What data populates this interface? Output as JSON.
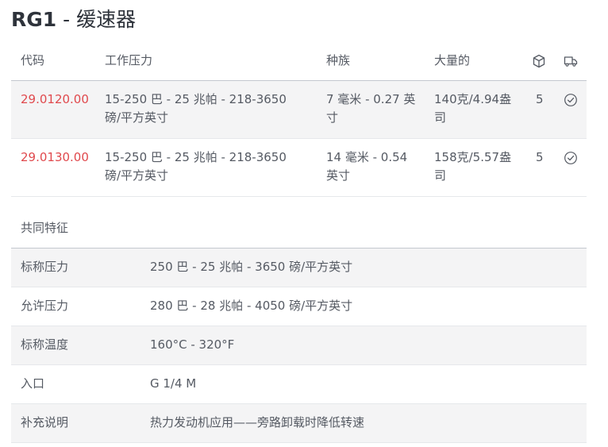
{
  "page": {
    "title_code": "RG1",
    "title_sep": " - ",
    "title_name": "缓速器"
  },
  "table": {
    "headers": {
      "code": "代码",
      "working_pressure": "工作压力",
      "type": "种族",
      "weight": "大量的"
    },
    "header_icons": [
      "package-icon",
      "truck-icon"
    ],
    "rows": [
      {
        "code": "29.0120.00",
        "pressure_line1": "15-250 巴 - 25 兆帕 - 218-3650",
        "pressure_line2": "磅/平方英寸",
        "type_line1": "7 毫米 - 0.27 英",
        "type_line2": "寸",
        "weight_line1": "140克/4.94盎",
        "weight_line2": "司",
        "pack": "5",
        "status_icon": "check-circle-icon"
      },
      {
        "code": "29.0130.00",
        "pressure_line1": "15-250 巴 - 25 兆帕 - 218-3650",
        "pressure_line2": "磅/平方英寸",
        "type_line1": "14 毫米 - 0.54",
        "type_line2": "英寸",
        "weight_line1": "158克/5.57盎",
        "weight_line2": "司",
        "pack": "5",
        "status_icon": "check-circle-icon"
      }
    ]
  },
  "common": {
    "title": "共同特征",
    "features": [
      {
        "label": "标称压力",
        "value": "250 巴 - 25 兆帕 - 3650 磅/平方英寸"
      },
      {
        "label": "允许压力",
        "value": "280 巴 - 28 兆帕 - 4050 磅/平方英寸"
      },
      {
        "label": "标称温度",
        "value": "160°C - 320°F"
      },
      {
        "label": "入口",
        "value": "G 1/4 M"
      },
      {
        "label": "补充说明",
        "value": "热力发动机应用——旁路卸载时降低转速"
      }
    ]
  },
  "colors": {
    "accent": "#e0494d",
    "text": "#555a63",
    "title": "#2e333b",
    "row_shade": "#f4f4f5"
  }
}
